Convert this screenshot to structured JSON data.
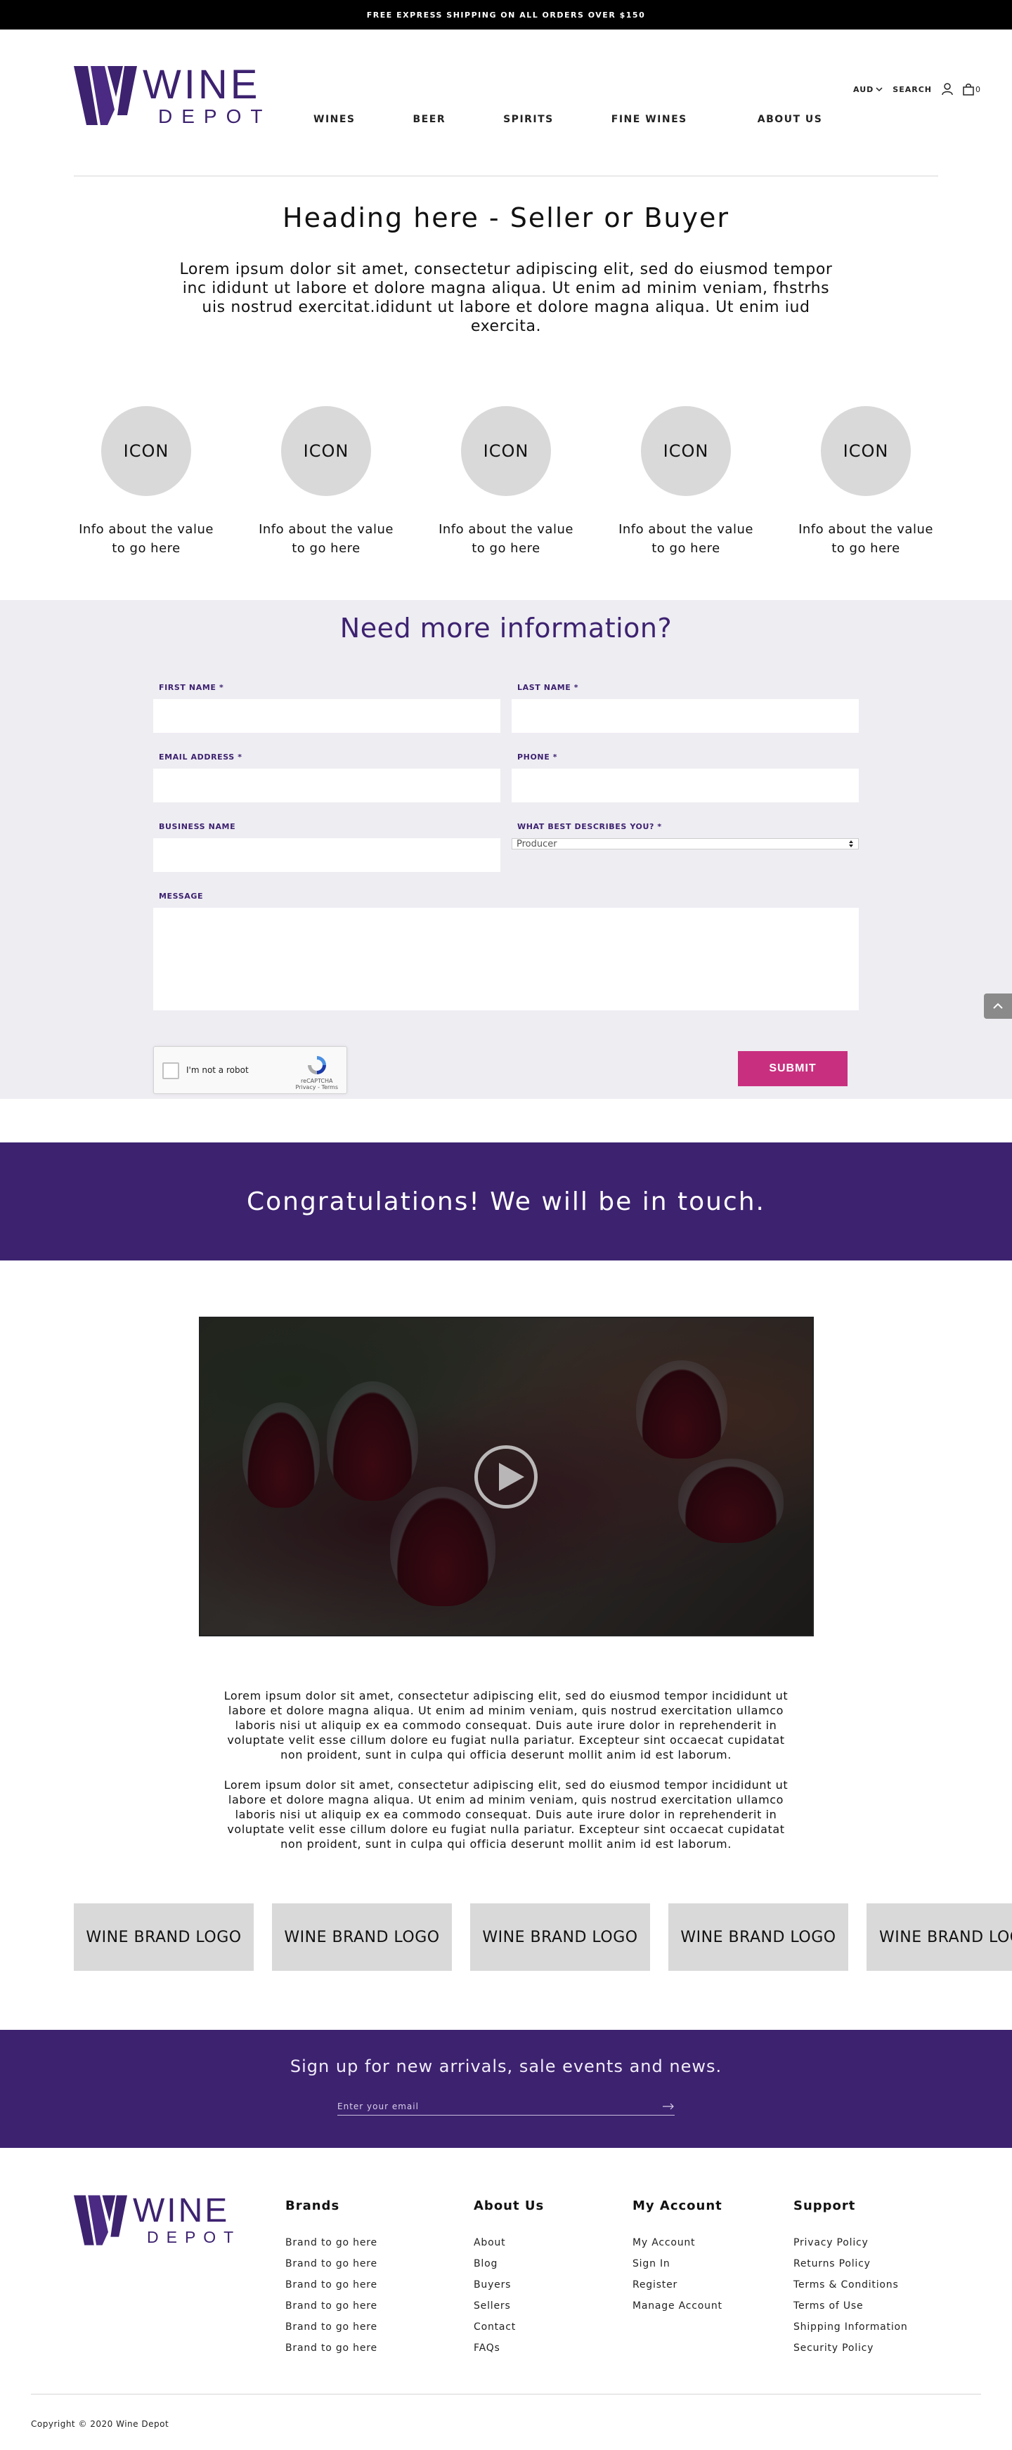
{
  "topbar": {
    "text": "FREE EXPRESS SHIPPING ON ALL ORDERS OVER $150"
  },
  "logo": {
    "line1": "WINE",
    "line2": "DEPOT"
  },
  "nav": [
    {
      "label": "WINES"
    },
    {
      "label": "BEER"
    },
    {
      "label": "SPIRITS"
    },
    {
      "label": "FINE WINES"
    },
    {
      "label": "ABOUT US"
    }
  ],
  "util": {
    "currency": "AUD",
    "search": "SEARCH",
    "cart_count": "0"
  },
  "hero": {
    "heading": "Heading here - Seller or Buyer",
    "text": "Lorem ipsum dolor sit amet, consectetur adipiscing elit, sed do eiusmod tempor inc ididunt ut labore et dolore magna aliqua. Ut enim ad minim veniam, fhstrhs uis nostrud exercitat.ididunt ut labore et dolore magna aliqua. Ut enim iud exercita."
  },
  "features": [
    {
      "icon": "ICON",
      "text": "Info about the value to go here"
    },
    {
      "icon": "ICON",
      "text": "Info about the value to go here"
    },
    {
      "icon": "ICON",
      "text": "Info about the value to go here"
    },
    {
      "icon": "ICON",
      "text": "Info about the value to go here"
    },
    {
      "icon": "ICON",
      "text": "Info about the value to go here"
    }
  ],
  "form": {
    "title": "Need more information?",
    "first_name": "FIRST NAME *",
    "last_name": "LAST NAME *",
    "email": "EMAIL ADDRESS *",
    "phone": "PHONE *",
    "business": "BUSINESS NAME",
    "describes": "WHAT BEST DESCRIBES YOU? *",
    "describes_value": "Producer",
    "message": "MESSAGE",
    "captcha_label": "I'm not a robot",
    "captcha_brand": "reCAPTCHA",
    "captcha_links": "Privacy - Terms",
    "submit": "SUBMIT"
  },
  "congrats": {
    "text": "Congratulations! We will be in touch."
  },
  "lorem": {
    "p1": "Lorem ipsum dolor sit amet, consectetur adipiscing elit, sed do eiusmod tempor incididunt ut labore et dolore magna aliqua. Ut enim ad minim veniam, quis nostrud exercitation ullamco laboris nisi ut aliquip ex ea commodo consequat. Duis aute irure dolor in reprehenderit in voluptate velit esse cillum dolore eu fugiat nulla pariatur. Excepteur sint occaecat cupidatat non proident, sunt in culpa qui officia deserunt mollit anim id est laborum.",
    "p2": "Lorem ipsum dolor sit amet, consectetur adipiscing elit, sed do eiusmod tempor incididunt ut labore et dolore magna aliqua. Ut enim ad minim veniam, quis nostrud exercitation ullamco laboris nisi ut aliquip ex ea commodo consequat. Duis aute irure dolor in reprehenderit in voluptate velit esse cillum dolore eu fugiat nulla pariatur. Excepteur sint occaecat cupidatat non proident, sunt in culpa qui officia deserunt mollit anim id est laborum."
  },
  "brands": [
    "WINE BRAND LOGO",
    "WINE BRAND LOGO",
    "WINE BRAND LOGO",
    "WINE BRAND LOGO",
    "WINE BRAND LOGO"
  ],
  "signup": {
    "title": "Sign up for new arrivals, sale events and news.",
    "placeholder": "Enter your email"
  },
  "footer": {
    "brands_title": "Brands",
    "brands": [
      "Brand to go here",
      "Brand to go here",
      "Brand to go here",
      "Brand to go here",
      "Brand to go here",
      "Brand to go here"
    ],
    "about_title": "About Us",
    "about": [
      "About",
      "Blog",
      "Buyers",
      "Sellers",
      "Contact",
      "FAQs"
    ],
    "account_title": "My Account",
    "account": [
      "My Account",
      "Sign In",
      "Register",
      "Manage Account"
    ],
    "support_title": "Support",
    "support": [
      "Privacy Policy",
      "Returns Policy",
      "Terms & Conditions",
      "Terms of Use",
      "Shipping Information",
      "Security Policy"
    ],
    "copyright": "Copyright © 2020 Wine Depot"
  },
  "colors": {
    "brand_purple": "#3d2270",
    "submit_pink": "#c8307f",
    "form_bg": "#eeedf2"
  }
}
